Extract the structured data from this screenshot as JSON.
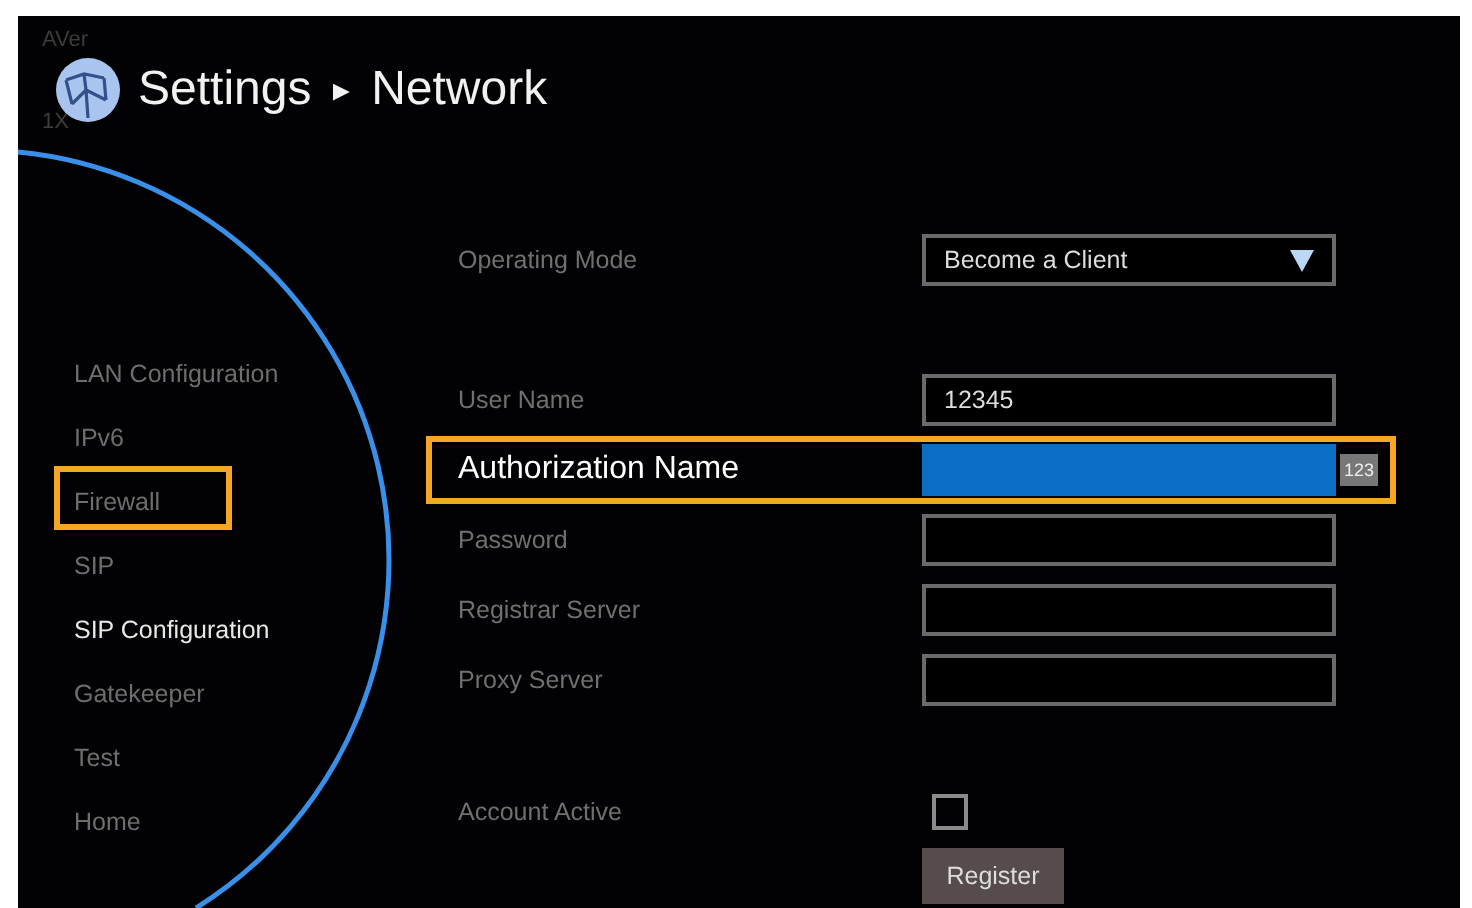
{
  "brand": {
    "logo_text": "AVer",
    "zoom_text": "1X"
  },
  "title": {
    "section": "Settings",
    "separator": "►",
    "page": "Network"
  },
  "sidebar": {
    "items": [
      {
        "label": "LAN Configuration",
        "selected": false,
        "highlighted": false
      },
      {
        "label": "IPv6",
        "selected": false,
        "highlighted": false
      },
      {
        "label": "Firewall",
        "selected": false,
        "highlighted": true
      },
      {
        "label": "SIP",
        "selected": false,
        "highlighted": false
      },
      {
        "label": "SIP Configuration",
        "selected": true,
        "highlighted": false
      },
      {
        "label": "Gatekeeper",
        "selected": false,
        "highlighted": false
      },
      {
        "label": "Test",
        "selected": false,
        "highlighted": false
      },
      {
        "label": "Home",
        "selected": false,
        "highlighted": false
      }
    ]
  },
  "form": {
    "rows": [
      {
        "kind": "dropdown",
        "label": "Operating Mode",
        "value": "Become a Client",
        "focused": false,
        "highlighted": false
      },
      {
        "kind": "text",
        "label": "User Name",
        "value": "12345",
        "focused": false,
        "highlighted": false
      },
      {
        "kind": "text",
        "label": "Authorization Name",
        "focused": true,
        "highlighted": true,
        "input_mode": "123"
      },
      {
        "kind": "text",
        "label": "Password",
        "focused": false,
        "highlighted": false
      },
      {
        "kind": "text",
        "label": "Registrar Server",
        "focused": false,
        "highlighted": false
      },
      {
        "kind": "text",
        "label": "Proxy Server",
        "focused": false,
        "highlighted": false
      },
      {
        "kind": "checkbox",
        "label": "Account Active",
        "checked": false,
        "focused": false,
        "highlighted": false
      },
      {
        "kind": "button",
        "label": "Register",
        "focused": false,
        "highlighted": false
      }
    ]
  }
}
